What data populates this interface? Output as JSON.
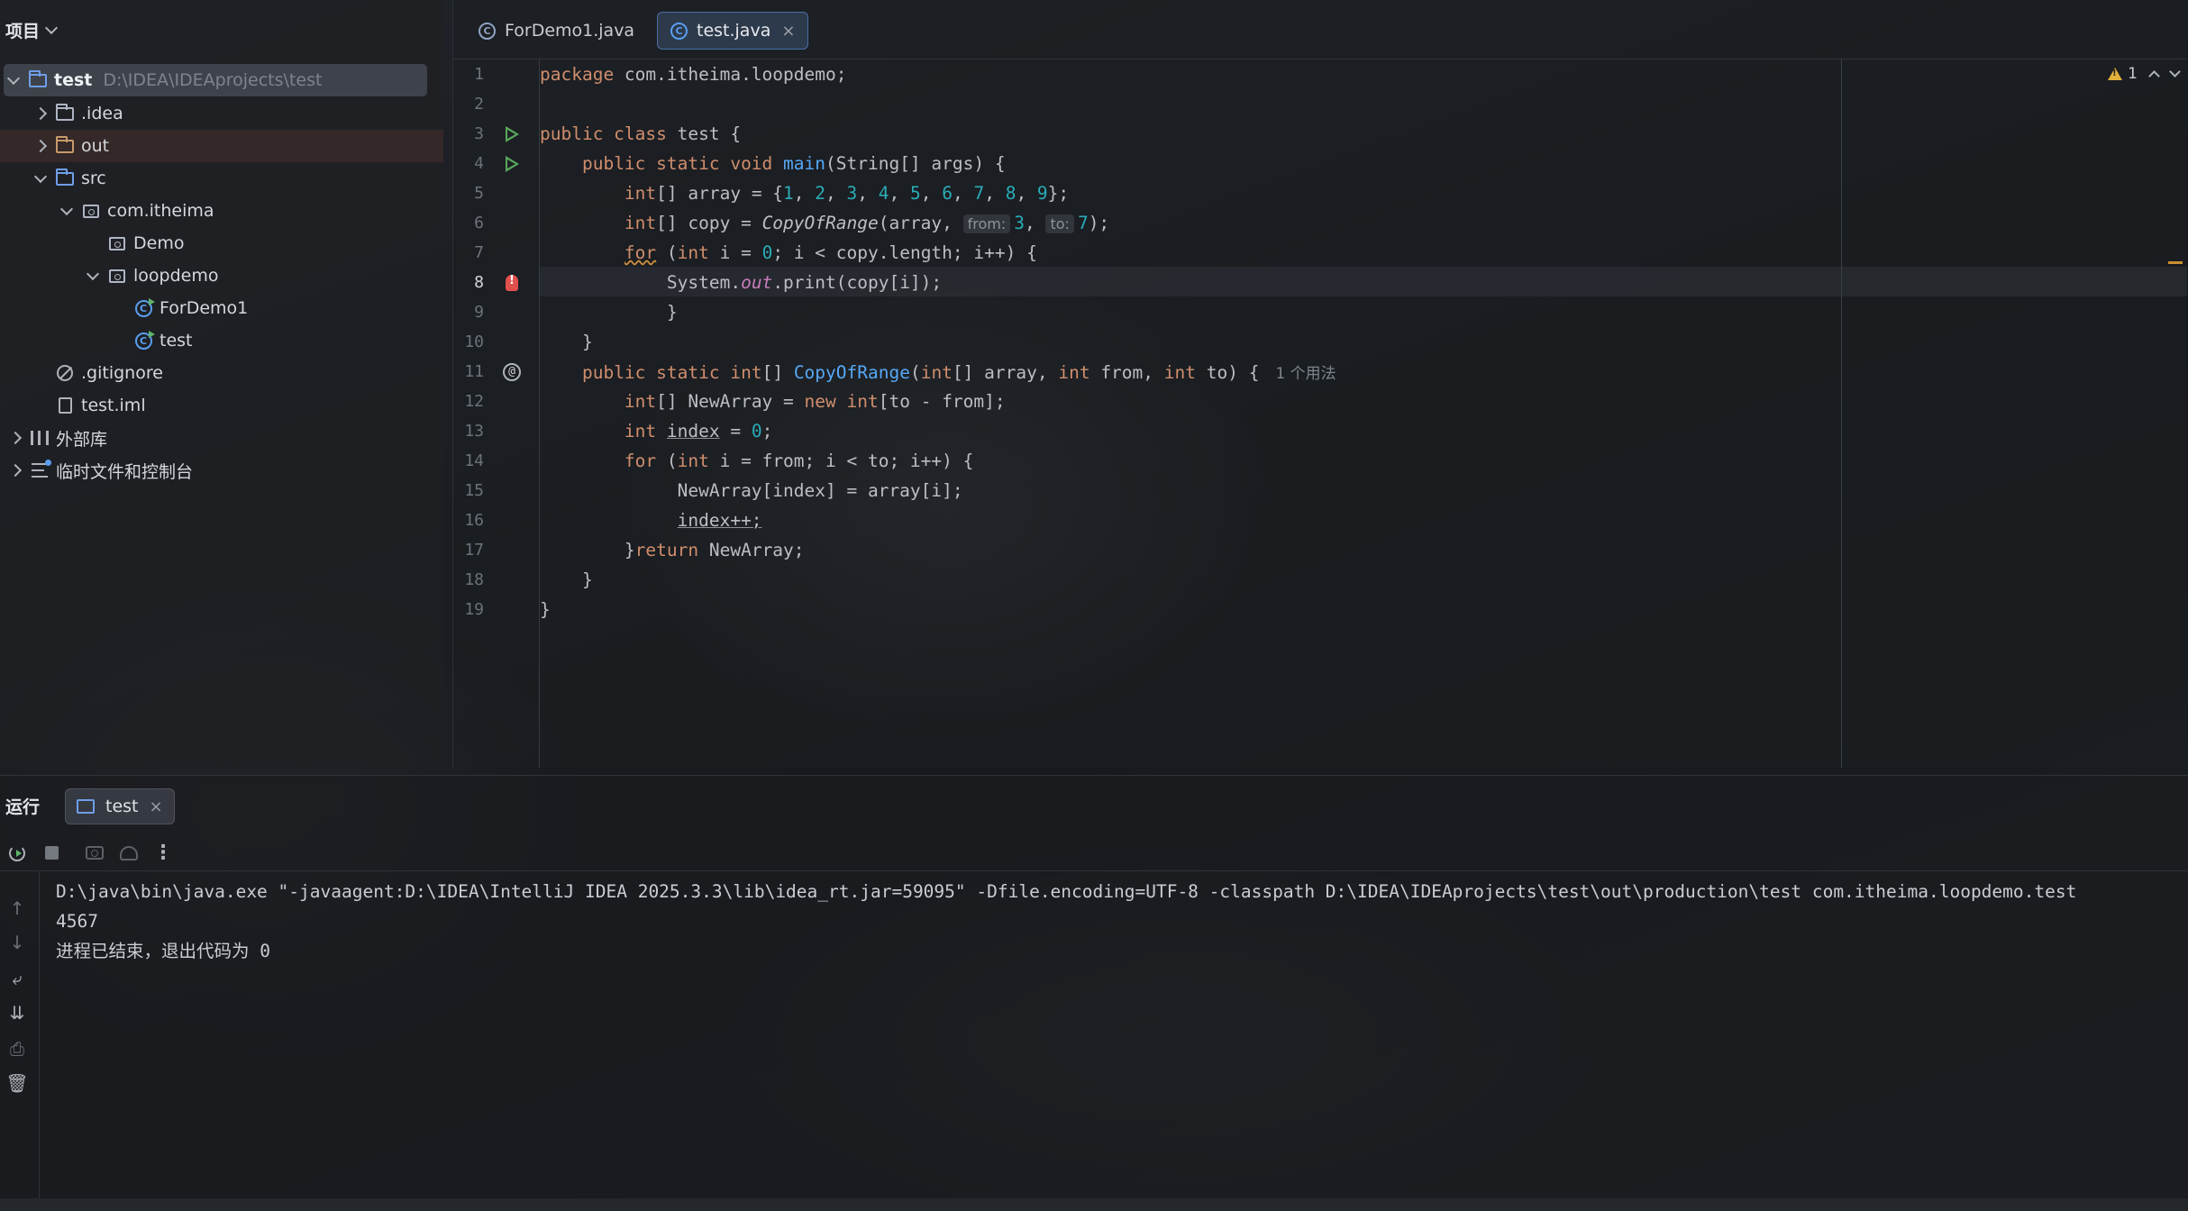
{
  "project_panel": {
    "title": "项目",
    "tree": [
      {
        "label": "test",
        "hint": "D:\\IDEA\\IDEAprojects\\test"
      },
      {
        "label": ".idea"
      },
      {
        "label": "out"
      },
      {
        "label": "src"
      },
      {
        "label": "com.itheima"
      },
      {
        "label": "Demo"
      },
      {
        "label": "loopdemo"
      },
      {
        "label": "ForDemo1"
      },
      {
        "label": "test"
      },
      {
        "label": ".gitignore"
      },
      {
        "label": "test.iml"
      },
      {
        "label": "外部库"
      },
      {
        "label": "临时文件和控制台"
      }
    ]
  },
  "editor": {
    "tabs": [
      {
        "label": "ForDemo1.java",
        "icon": "class-icon"
      },
      {
        "label": "test.java",
        "icon": "class-run-icon",
        "active": true
      }
    ],
    "warnings_count": "1",
    "line_numbers": [
      "1",
      "2",
      "3",
      "4",
      "5",
      "6",
      "7",
      "8",
      "9",
      "10",
      "11",
      "12",
      "13",
      "14",
      "15",
      "16",
      "17",
      "18",
      "19"
    ],
    "current_line": 8,
    "code": {
      "l1_kw": "package",
      "l1_rest": " com.itheima.loopdemo;",
      "l3_kw": "public class",
      "l3_rest": " test {",
      "l4_kw": "public static void",
      "l4_fn": "main",
      "l4_rest": "(String[] args) {",
      "l5_kw": "int",
      "l5_a": "[] array = {",
      "l5_nums": [
        "1",
        "2",
        "3",
        "4",
        "5",
        "6",
        "7",
        "8",
        "9"
      ],
      "l5_end": "};",
      "l6_kw": "int",
      "l6_a": "[] copy = ",
      "l6_call": "CopyOfRange",
      "l6_b": "(array, ",
      "l6_hint_from": "from:",
      "l6_from": "3",
      "l6_hint_to": "to:",
      "l6_to": "7",
      "l6_end": ");",
      "l7_for": "for",
      "l7_a": " (",
      "l7_int": "int",
      "l7_b": " i = ",
      "l7_zero": "0",
      "l7_c": "; i < copy.length; i++) {",
      "l8_a": "System.",
      "l8_out": "out",
      "l8_b": ".print(copy[i]);",
      "l9": "}",
      "l10": "}",
      "l11_kw1": "public static",
      "l11_kw2": "int",
      "l11_a": "[] ",
      "l11_fn": "CopyOfRange",
      "l11_b": "(",
      "l11_int1": "int",
      "l11_c": "[] array, ",
      "l11_int2": "int",
      "l11_d": " from, ",
      "l11_int3": "int",
      "l11_e": " to) {",
      "l11_usage": "1 个用法",
      "l12_int1": "int",
      "l12_a": "[] NewArray = ",
      "l12_new": "new",
      "l12_int2": "int",
      "l12_b": "[to - from];",
      "l13_int": "int",
      "l13_var": "index",
      "l13_a": " = ",
      "l13_zero": "0",
      "l13_end": ";",
      "l14_for": "for",
      "l14_a": " (",
      "l14_int": "int",
      "l14_b": " i = from; i < to; i++) {",
      "l15": "NewArray[index] = array[i];",
      "l16": "index++;",
      "l17_a": "}",
      "l17_ret": "return",
      "l17_b": " NewArray;",
      "l18": "}",
      "l19": "}"
    }
  },
  "run_panel": {
    "title": "运行",
    "tab_label": "test",
    "console": [
      "D:\\java\\bin\\java.exe \"-javaagent:D:\\IDEA\\IntelliJ IDEA 2025.3.3\\lib\\idea_rt.jar=59095\" -Dfile.encoding=UTF-8 -classpath D:\\IDEA\\IDEAprojects\\test\\out\\production\\test com.itheima.loopdemo.test",
      "4567",
      "进程已结束，退出代码为 0"
    ]
  },
  "colors": {
    "keyword": "#cf8e6d",
    "function": "#56a8f5",
    "number": "#2aacb8",
    "static_field": "#c77dbb",
    "run_green": "#58a65c",
    "error_red": "#e0504c",
    "warning_yellow": "#e2b13c"
  }
}
